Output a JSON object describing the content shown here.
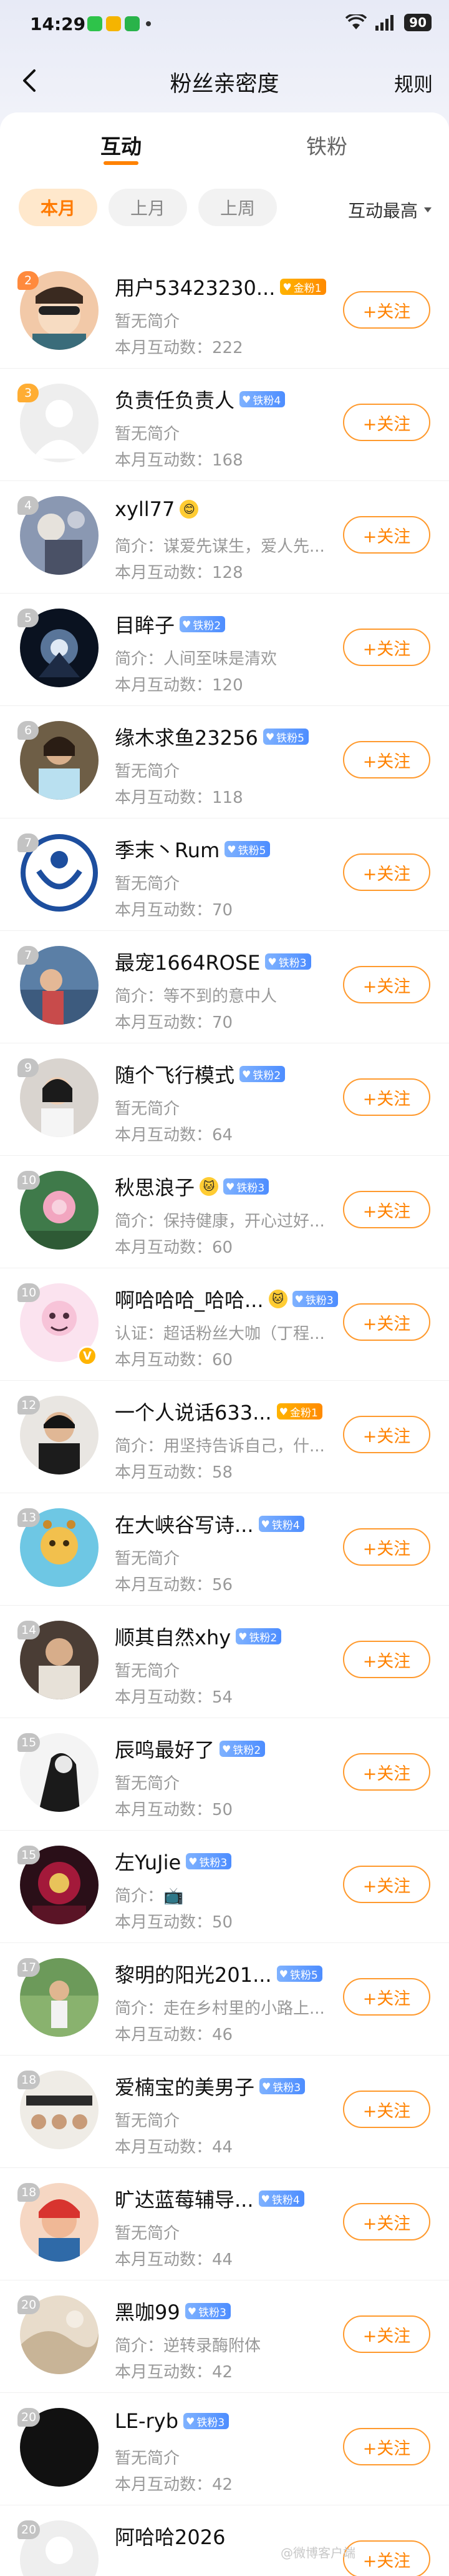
{
  "status_bar": {
    "time": "14:29",
    "battery": "90"
  },
  "header": {
    "title": "粉丝亲密度",
    "rules": "规则"
  },
  "tabs": [
    {
      "label": "互动"
    },
    {
      "label": "铁粉"
    }
  ],
  "filters": [
    {
      "label": "本月"
    },
    {
      "label": "上月"
    },
    {
      "label": "上周"
    }
  ],
  "sort": {
    "label": "互动最高"
  },
  "follow_label": "+关注",
  "users": [
    {
      "rank": "2",
      "name": "用户53423230...",
      "badge": "金粉1",
      "badge_type": "gold",
      "bio": "暂无简介",
      "count": "本月互动数：222"
    },
    {
      "rank": "3",
      "name": "负责任负责人",
      "badge": "铁粉4",
      "badge_type": "blue",
      "bio": "暂无简介",
      "count": "本月互动数：168"
    },
    {
      "rank": "4",
      "name": "xyll77",
      "badge": "",
      "badge_type": "emoji",
      "bio": "简介：谋爱先谋生，爱人先...",
      "count": "本月互动数：128"
    },
    {
      "rank": "5",
      "name": "目眸子",
      "badge": "铁粉2",
      "badge_type": "blue",
      "bio": "简介：人间至味是清欢",
      "count": "本月互动数：120"
    },
    {
      "rank": "6",
      "name": "缘木求鱼23256",
      "badge": "铁粉5",
      "badge_type": "blue",
      "bio": "暂无简介",
      "count": "本月互动数：118"
    },
    {
      "rank": "7",
      "name": "季末丶Rum",
      "badge": "铁粉5",
      "badge_type": "blue",
      "bio": "暂无简介",
      "count": "本月互动数：70"
    },
    {
      "rank": "7",
      "name": "最宠1664ROSE",
      "badge": "铁粉3",
      "badge_type": "blue",
      "bio": "简介：等不到的意中人",
      "count": "本月互动数：70"
    },
    {
      "rank": "9",
      "name": "随个飞行模式",
      "badge": "铁粉2",
      "badge_type": "blue",
      "bio": "暂无简介",
      "count": "本月互动数：64"
    },
    {
      "rank": "10",
      "name": "秋思浪子",
      "badge": "铁粉3",
      "badge_type": "blue",
      "bio": "简介：保持健康，开心过好...",
      "count": "本月互动数：60"
    },
    {
      "rank": "10",
      "name": "啊哈哈哈_哈哈...",
      "badge": "铁粉3",
      "badge_type": "blue",
      "bio": "认证：超话粉丝大咖（丁程...",
      "count": "本月互动数：60"
    },
    {
      "rank": "12",
      "name": "一个人说话633...",
      "badge": "金粉1",
      "badge_type": "gold",
      "bio": "简介：用坚持告诉自己，什...",
      "count": "本月互动数：58"
    },
    {
      "rank": "13",
      "name": "在大峡谷写诗...",
      "badge": "铁粉4",
      "badge_type": "blue",
      "bio": "暂无简介",
      "count": "本月互动数：56"
    },
    {
      "rank": "14",
      "name": "顺其自然xhy",
      "badge": "铁粉2",
      "badge_type": "blue",
      "bio": "暂无简介",
      "count": "本月互动数：54"
    },
    {
      "rank": "15",
      "name": "辰鸣最好了",
      "badge": "铁粉2",
      "badge_type": "blue",
      "bio": "暂无简介",
      "count": "本月互动数：50"
    },
    {
      "rank": "15",
      "name": "左YuJie",
      "badge": "铁粉3",
      "badge_type": "blue",
      "bio": "简介：📺",
      "count": "本月互动数：50"
    },
    {
      "rank": "17",
      "name": "黎明的阳光201...",
      "badge": "铁粉5",
      "badge_type": "blue",
      "bio": "简介：走在乡村里的小路上...",
      "count": "本月互动数：46"
    },
    {
      "rank": "18",
      "name": "爱楠宝的美男子",
      "badge": "铁粉3",
      "badge_type": "blue",
      "bio": "暂无简介",
      "count": "本月互动数：44"
    },
    {
      "rank": "18",
      "name": "旷达蓝莓辅导...",
      "badge": "铁粉4",
      "badge_type": "blue",
      "bio": "暂无简介",
      "count": "本月互动数：44"
    },
    {
      "rank": "20",
      "name": "黑咖99",
      "badge": "铁粉3",
      "badge_type": "blue",
      "bio": "简介：逆转录酶附体",
      "count": "本月互动数：42"
    },
    {
      "rank": "20",
      "name": "LE-ryb",
      "badge": "铁粉3",
      "badge_type": "blue",
      "bio": "暂无简介",
      "count": "本月互动数：42"
    },
    {
      "rank": "20",
      "name": "阿哈哈2026",
      "badge": "",
      "badge_type": "none",
      "bio": "",
      "count": ""
    }
  ],
  "watermark": "@微博客户端"
}
